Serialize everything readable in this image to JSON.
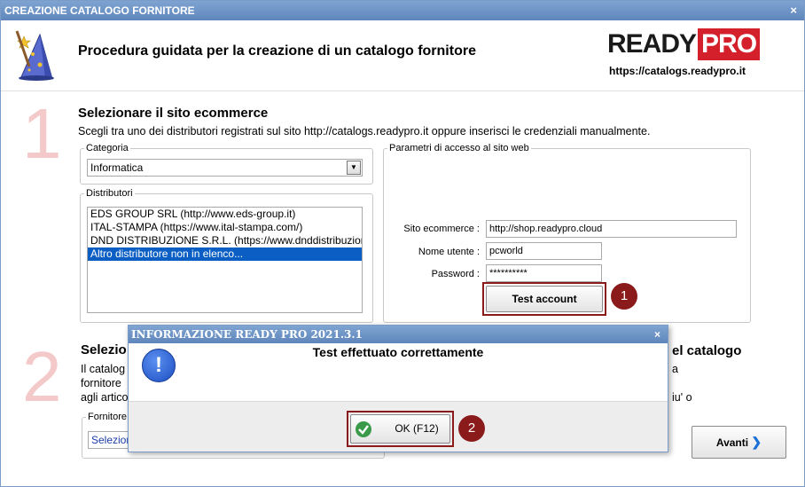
{
  "window": {
    "title": "CREAZIONE CATALOGO FORNITORE",
    "close_glyph": "×"
  },
  "header": {
    "title": "Procedura guidata per la creazione di un catalogo fornitore",
    "logo_ready": "READY",
    "logo_pro": "PRO",
    "logo_url": "https://catalogs.readypro.it",
    "icon": "wizard-hat-icon"
  },
  "step1": {
    "number": "1",
    "title": "Selezionare il sito ecommerce",
    "description": "Scegli tra uno dei distributori registrati sul sito http://catalogs.readypro.it oppure inserisci le credenziali manualmente.",
    "categoria_label": "Categoria",
    "categoria_value": "Informatica",
    "distributori_label": "Distributori",
    "distributori": [
      "EDS GROUP SRL (http://www.eds-group.it)",
      "ITAL-STAMPA (https://www.ital-stampa.com/)",
      "DND DISTRIBUZIONE S.R.L. (https://www.dnddistribuzione.it)",
      "Altro distributore non in elenco..."
    ],
    "selected_index": 3,
    "access_group_label": "Parametri di accesso al sito web",
    "sito_label": "Sito ecommerce :",
    "sito_value": "http://shop.readypro.cloud",
    "utente_label": "Nome utente :",
    "utente_value": "pcworld",
    "password_label": "Password :",
    "password_value": "**********",
    "test_button": "Test account",
    "annotation": "1"
  },
  "step2": {
    "number": "2",
    "title_partial": "Selezio",
    "title_end": "el catalogo",
    "desc_line1_start": "Il catalog",
    "desc_line1_end": "a",
    "desc_line2_start": "fornitore",
    "desc_line3_start": "agli artico",
    "desc_line3_end": "iu' o",
    "fornitore_label": "Fornitore",
    "fornitore_value": "Seleziona"
  },
  "footer": {
    "avanti_label": "Avanti",
    "avanti_icon": "chevron-right-icon"
  },
  "dialog": {
    "title": "INFORMAZIONE READY PRO 2021.3.1",
    "close_glyph": "×",
    "message": "Test effettuato correttamente",
    "ok_label": "OK (F12)",
    "icon": "exclamation-info-icon",
    "ok_icon": "check-circle-icon",
    "annotation": "2"
  }
}
